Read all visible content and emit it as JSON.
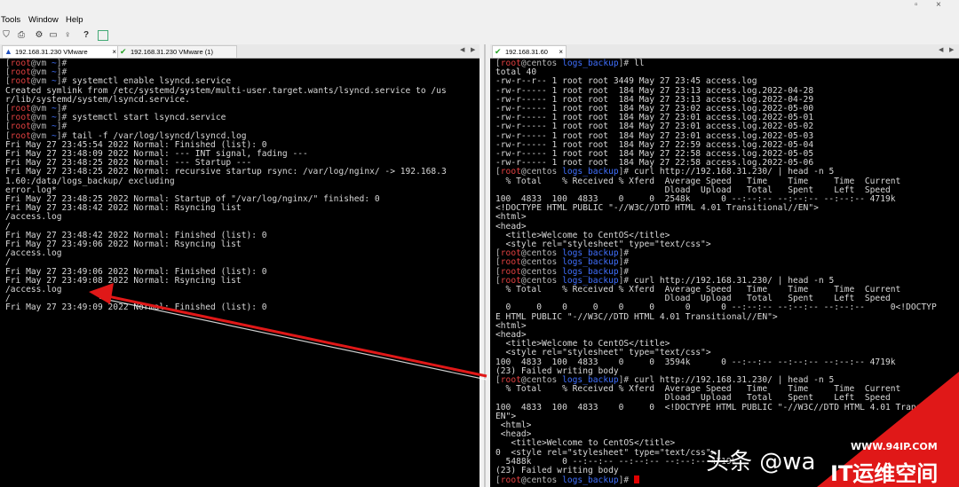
{
  "menu": {
    "tools": "Tools",
    "window": "Window",
    "help": "Help"
  },
  "toolbar_icons": [
    "binoculars-icon",
    "print-icon",
    "gear-icon",
    "window-icon",
    "key-icon",
    "help-icon",
    "screen-icon"
  ],
  "left_tabs": [
    {
      "label": "192.168.31.230 VMware",
      "icon": "warning-icon",
      "status_color": "#1f4fbf"
    },
    {
      "label": "192.168.31.230 VMware (1)",
      "icon": "check-icon",
      "status_color": "#22a022"
    }
  ],
  "right_tabs": [
    {
      "label": "192.168.31.60",
      "icon": "check-icon",
      "status_color": "#22a022"
    }
  ],
  "left_prompt": {
    "user": "root",
    "host": "vm",
    "dir": "~"
  },
  "right_prompt": {
    "user": "root",
    "host": "centos",
    "dir": "logs_backup"
  },
  "left_lines": [
    {
      "type": "prompt",
      "cmd": ""
    },
    {
      "type": "prompt",
      "cmd": ""
    },
    {
      "type": "prompt",
      "cmd": " systemctl enable lsyncd.service"
    },
    {
      "type": "text",
      "text": "Created symlink from /etc/systemd/system/multi-user.target.wants/lsyncd.service to /us"
    },
    {
      "type": "text",
      "text": "r/lib/systemd/system/lsyncd.service."
    },
    {
      "type": "prompt",
      "cmd": ""
    },
    {
      "type": "prompt",
      "cmd": " systemctl start lsyncd.service"
    },
    {
      "type": "prompt",
      "cmd": ""
    },
    {
      "type": "prompt",
      "cmd": " tail -f /var/log/lsyncd/lsyncd.log"
    },
    {
      "type": "text",
      "text": "Fri May 27 23:45:54 2022 Normal: Finished (list): 0"
    },
    {
      "type": "text",
      "text": "Fri May 27 23:48:09 2022 Normal: --- INT signal, fading ---"
    },
    {
      "type": "text",
      "text": "Fri May 27 23:48:25 2022 Normal: --- Startup ---"
    },
    {
      "type": "text",
      "text": "Fri May 27 23:48:25 2022 Normal: recursive startup rsync: /var/log/nginx/ -> 192.168.3"
    },
    {
      "type": "text",
      "text": "1.60:/data/logs_backup/ excluding"
    },
    {
      "type": "text",
      "text": "error.log*"
    },
    {
      "type": "text",
      "text": "Fri May 27 23:48:25 2022 Normal: Startup of \"/var/log/nginx/\" finished: 0"
    },
    {
      "type": "text",
      "text": "Fri May 27 23:48:42 2022 Normal: Rsyncing list"
    },
    {
      "type": "text",
      "text": "/access.log"
    },
    {
      "type": "text",
      "text": "/"
    },
    {
      "type": "text",
      "text": "Fri May 27 23:48:42 2022 Normal: Finished (list): 0"
    },
    {
      "type": "text",
      "text": "Fri May 27 23:49:06 2022 Normal: Rsyncing list"
    },
    {
      "type": "text",
      "text": "/access.log"
    },
    {
      "type": "text",
      "text": "/"
    },
    {
      "type": "text",
      "text": "Fri May 27 23:49:06 2022 Normal: Finished (list): 0"
    },
    {
      "type": "text",
      "text": "Fri May 27 23:49:08 2022 Normal: Rsyncing list"
    },
    {
      "type": "text",
      "text": "/access.log"
    },
    {
      "type": "text",
      "text": "/"
    },
    {
      "type": "text",
      "text": "Fri May 27 23:49:09 2022 Normal: Finished (list): 0"
    }
  ],
  "right_lines": [
    {
      "type": "prompt",
      "cmd": " ll"
    },
    {
      "type": "text",
      "text": "total 40"
    },
    {
      "type": "text",
      "text": "-rw-r--r-- 1 root root 3449 May 27 23:45 access.log"
    },
    {
      "type": "text",
      "text": "-rw-r----- 1 root root  184 May 27 23:13 access.log.2022-04-28"
    },
    {
      "type": "text",
      "text": "-rw-r----- 1 root root  184 May 27 23:13 access.log.2022-04-29"
    },
    {
      "type": "text",
      "text": "-rw-r----- 1 root root  184 May 27 23:02 access.log.2022-05-00"
    },
    {
      "type": "text",
      "text": "-rw-r----- 1 root root  184 May 27 23:01 access.log.2022-05-01"
    },
    {
      "type": "text",
      "text": "-rw-r----- 1 root root  184 May 27 23:01 access.log.2022-05-02"
    },
    {
      "type": "text",
      "text": "-rw-r----- 1 root root  184 May 27 23:01 access.log.2022-05-03"
    },
    {
      "type": "text",
      "text": "-rw-r----- 1 root root  184 May 27 22:59 access.log.2022-05-04"
    },
    {
      "type": "text",
      "text": "-rw-r----- 1 root root  184 May 27 22:58 access.log.2022-05-05"
    },
    {
      "type": "text",
      "text": "-rw-r----- 1 root root  184 May 27 22:58 access.log.2022-05-06"
    },
    {
      "type": "prompt",
      "cmd": " curl http://192.168.31.230/ | head -n 5"
    },
    {
      "type": "text",
      "text": "  % Total    % Received % Xferd  Average Speed   Time    Time     Time  Current"
    },
    {
      "type": "text",
      "text": "                                 Dload  Upload   Total   Spent    Left  Speed"
    },
    {
      "type": "text",
      "text": "100  4833  100  4833    0     0  2548k      0 --:--:-- --:--:-- --:--:-- 4719k"
    },
    {
      "type": "text",
      "text": "<!DOCTYPE HTML PUBLIC \"-//W3C//DTD HTML 4.01 Transitional//EN\">"
    },
    {
      "type": "text",
      "text": "<html>"
    },
    {
      "type": "text",
      "text": "<head>"
    },
    {
      "type": "text",
      "text": "  <title>Welcome to CentOS</title>"
    },
    {
      "type": "text",
      "text": "  <style rel=\"stylesheet\" type=\"text/css\">"
    },
    {
      "type": "prompt",
      "cmd": ""
    },
    {
      "type": "prompt",
      "cmd": ""
    },
    {
      "type": "prompt",
      "cmd": ""
    },
    {
      "type": "prompt",
      "cmd": " curl http://192.168.31.230/ | head -n 5"
    },
    {
      "type": "text",
      "text": "  % Total    % Received % Xferd  Average Speed   Time    Time     Time  Current"
    },
    {
      "type": "text",
      "text": "                                 Dload  Upload   Total   Spent    Left  Speed"
    },
    {
      "type": "text",
      "text": "  0     0    0     0    0     0      0      0 --:--:-- --:--:-- --:--:--     0<!DOCTYP"
    },
    {
      "type": "text",
      "text": "E HTML PUBLIC \"-//W3C//DTD HTML 4.01 Transitional//EN\">"
    },
    {
      "type": "text",
      "text": "<html>"
    },
    {
      "type": "text",
      "text": "<head>"
    },
    {
      "type": "text",
      "text": "  <title>Welcome to CentOS</title>"
    },
    {
      "type": "text",
      "text": "  <style rel=\"stylesheet\" type=\"text/css\">"
    },
    {
      "type": "text",
      "text": "100  4833  100  4833    0     0  3594k      0 --:--:-- --:--:-- --:--:-- 4719k"
    },
    {
      "type": "text",
      "text": "(23) Failed writing body"
    },
    {
      "type": "prompt",
      "cmd": " curl http://192.168.31.230/ | head -n 5"
    },
    {
      "type": "text",
      "text": "  % Total    % Received % Xferd  Average Speed   Time    Time     Time  Current"
    },
    {
      "type": "text",
      "text": "                                 Dload  Upload   Total   Spent    Left  Speed"
    },
    {
      "type": "text",
      "text": "100  4833  100  4833    0     0  <!DOCTYPE HTML PUBLIC \"-//W3C//DTD HTML 4.01 Transi"
    },
    {
      "type": "text",
      "text": "EN\">"
    },
    {
      "type": "text",
      "text": " <html>"
    },
    {
      "type": "text",
      "text": " <head>"
    },
    {
      "type": "text",
      "text": "   <title>Welcome to CentOS</title>"
    },
    {
      "type": "text",
      "text": "0  <style rel=\"stylesheet\" type=\"text/css\">"
    },
    {
      "type": "text",
      "text": "  5488k      0 --:--:-- --:--:-- --:--:-- 4719k"
    },
    {
      "type": "text",
      "text": "(23) Failed writing body"
    },
    {
      "type": "prompt",
      "cmd": " ",
      "cursor": true
    }
  ],
  "watermark": {
    "text1": "头条 @wa",
    "site": "WWW.94IP.COM",
    "brand": "IT运维空间"
  },
  "colors": {
    "arrow": "#e01818",
    "badge": "#e01818",
    "prompt_root": "#e04040",
    "prompt_dir": "#4070ff",
    "cursor": "#e00000"
  }
}
